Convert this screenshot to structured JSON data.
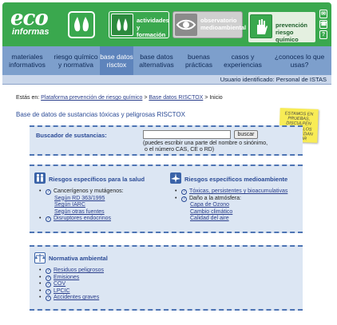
{
  "header": {
    "logo_top": "eco",
    "logo_bottom": "informas",
    "tabs": [
      {
        "label": "actividades y formación"
      },
      {
        "label": "observatorio medioambiental"
      },
      {
        "label": "prevención riesgo químico"
      }
    ],
    "side_icons": [
      "✉",
      "☎",
      "?"
    ]
  },
  "nav": {
    "items": [
      {
        "label": "materiales informativos"
      },
      {
        "label": "riesgo químico y normativa"
      },
      {
        "label": "base datos risctox"
      },
      {
        "label": "base datos alternativas"
      },
      {
        "label": "buenas prácticas"
      },
      {
        "label": "casos y experiencias"
      },
      {
        "label": "¿conoces lo que usas?"
      }
    ]
  },
  "userbar": {
    "text": "Usuario identificado: Personal de ISTAS"
  },
  "breadcrumb": {
    "prefix": "Estás en:",
    "link1": "Plataforma prevención de riesgo químico",
    "sep": ">",
    "link2": "Base datos RISCTOX",
    "current": "> Inicio"
  },
  "page_title": "Base de datos de sustancias tóxicas y peligrosas RISCTOX",
  "note": {
    "lines": [
      "ESTAMOS EN",
      "PRUEBAS,",
      "DISCULPEN",
      "LOS FALLOS",
      "QUE PUEDAN",
      "SURGIR"
    ]
  },
  "search": {
    "label": "Buscador de sustancias:",
    "input_value": "",
    "button": "buscar",
    "hint_line1": "(puedes escribir una parte del nombre o sinónimo,",
    "hint_line2": "o el número CAS, CE o RD)"
  },
  "health": {
    "title": "Riesgos específicos para la salud",
    "carcinogen_label": "Cancerígenos y mutágenos:",
    "carcinogen_links": [
      "Según RD 363/1995",
      "Según IARC",
      "Según otras fuentes"
    ],
    "disruptors": "Disruptores endocrinos"
  },
  "environment": {
    "title": "Riesgos específicos medioambiente",
    "toxic": "Tóxicas, persistentes y bioacumulativas",
    "atmosphere_label": "Daño a la atmósfera:",
    "atmosphere_links": [
      "Capa de Ozono",
      "Cambio climático",
      "Calidad del aire"
    ]
  },
  "normativa": {
    "title": "Normativa ambiental",
    "items": [
      "Residuos peligrosos",
      "Emisiones",
      "COV",
      "LPCIC",
      "Accidentes graves"
    ]
  }
}
